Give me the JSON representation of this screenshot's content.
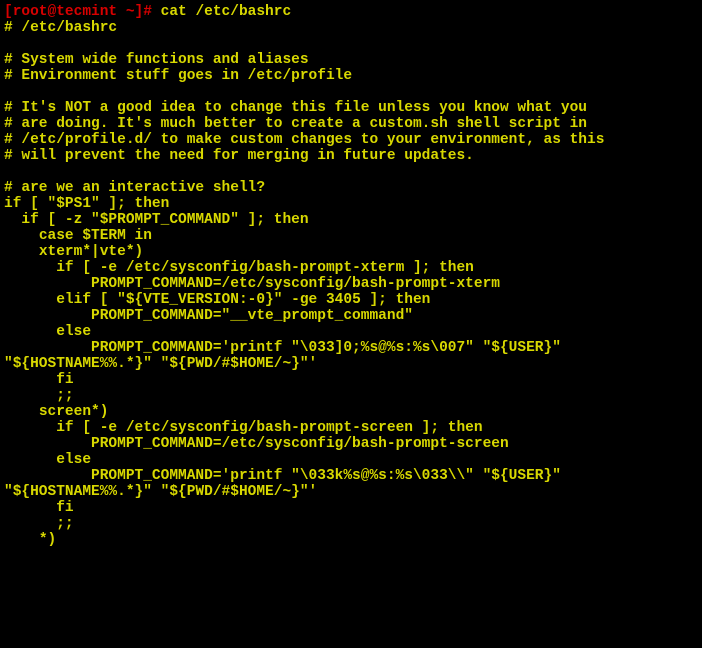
{
  "prompt": {
    "bracket_open": "[",
    "user_host": "root@tecmint",
    "tilde": " ~",
    "bracket_close": "]",
    "symbol": "# "
  },
  "command": "cat /etc/bashrc",
  "lines": [
    "# /etc/bashrc",
    "",
    "# System wide functions and aliases",
    "# Environment stuff goes in /etc/profile",
    "",
    "# It's NOT a good idea to change this file unless you know what you",
    "# are doing. It's much better to create a custom.sh shell script in",
    "# /etc/profile.d/ to make custom changes to your environment, as this",
    "# will prevent the need for merging in future updates.",
    "",
    "# are we an interactive shell?",
    "if [ \"$PS1\" ]; then",
    "  if [ -z \"$PROMPT_COMMAND\" ]; then",
    "    case $TERM in",
    "    xterm*|vte*)",
    "      if [ -e /etc/sysconfig/bash-prompt-xterm ]; then",
    "          PROMPT_COMMAND=/etc/sysconfig/bash-prompt-xterm",
    "      elif [ \"${VTE_VERSION:-0}\" -ge 3405 ]; then",
    "          PROMPT_COMMAND=\"__vte_prompt_command\"",
    "      else",
    "          PROMPT_COMMAND='printf \"\\033]0;%s@%s:%s\\007\" \"${USER}\" \"${HOSTNAME%%.*}\" \"${PWD/#$HOME/~}\"'",
    "      fi",
    "      ;;",
    "    screen*)",
    "      if [ -e /etc/sysconfig/bash-prompt-screen ]; then",
    "          PROMPT_COMMAND=/etc/sysconfig/bash-prompt-screen",
    "      else",
    "          PROMPT_COMMAND='printf \"\\033k%s@%s:%s\\033\\\\\" \"${USER}\" \"${HOSTNAME%%.*}\" \"${PWD/#$HOME/~}\"'",
    "      fi",
    "      ;;",
    "    *)"
  ]
}
